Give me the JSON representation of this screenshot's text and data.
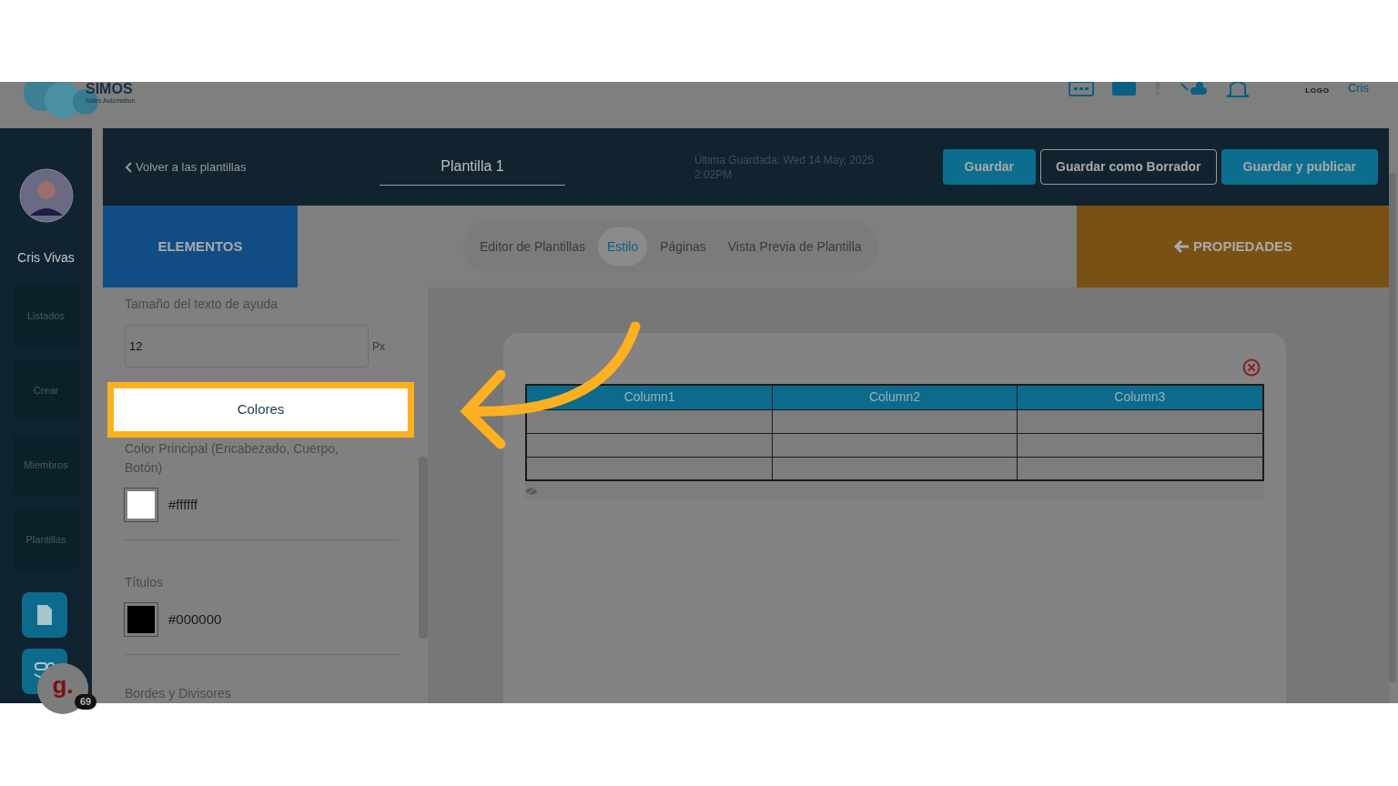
{
  "header": {
    "logo_text": "SIMOS",
    "logo_subtitle": "Sales Automation",
    "logo_badge": "LOGO",
    "user_short": "Cris"
  },
  "sidebar": {
    "user_name": "Cris Vivas",
    "items": [
      {
        "label": "Listados"
      },
      {
        "label": "Crear"
      },
      {
        "label": "Miembros"
      },
      {
        "label": "Plantillas"
      }
    ],
    "chat_badge": {
      "letter": "g.",
      "count": "69"
    }
  },
  "toolbar": {
    "back": "Volver a las plantillas",
    "title": "Plantilla 1",
    "last_saved": "Última Guardada: Wed 14 May, 2025 2:02PM",
    "buttons": [
      {
        "label": "Guardar",
        "kind": "filled"
      },
      {
        "label": "Guardar como Borrador",
        "kind": "outline"
      },
      {
        "label": "Guardar y publicar",
        "kind": "filled"
      }
    ]
  },
  "elements_tab": "ELEMENTOS",
  "properties_tab": "PROPIEDADES",
  "tabs": [
    {
      "label": "Editor de Plantillas",
      "selected": false
    },
    {
      "label": "Estilo",
      "selected": true
    },
    {
      "label": "Páginas",
      "selected": false
    },
    {
      "label": "Vista Previa de Plantilla",
      "selected": false
    }
  ],
  "panel": {
    "help_size_label": "Tamaño del texto de ayuda",
    "help_size_value": "12",
    "help_size_unit": "Px",
    "section": "Colores",
    "colors": [
      {
        "label": "Color Principal (Encabezado, Cuerpo, Botón)",
        "value": "#ffffff",
        "color": "#ffffff"
      },
      {
        "label": "Títulos",
        "value": "#000000",
        "color": "#000000"
      }
    ],
    "next_label": "Bordes y Divisores"
  },
  "table": {
    "columns": [
      "Column1",
      "Column2",
      "Column3"
    ],
    "row_count_rows": [
      {
        "cells": [
          "",
          "",
          ""
        ]
      },
      {
        "cells": [
          "",
          "",
          ""
        ]
      },
      {
        "cells": [
          "",
          "",
          ""
        ]
      }
    ]
  }
}
